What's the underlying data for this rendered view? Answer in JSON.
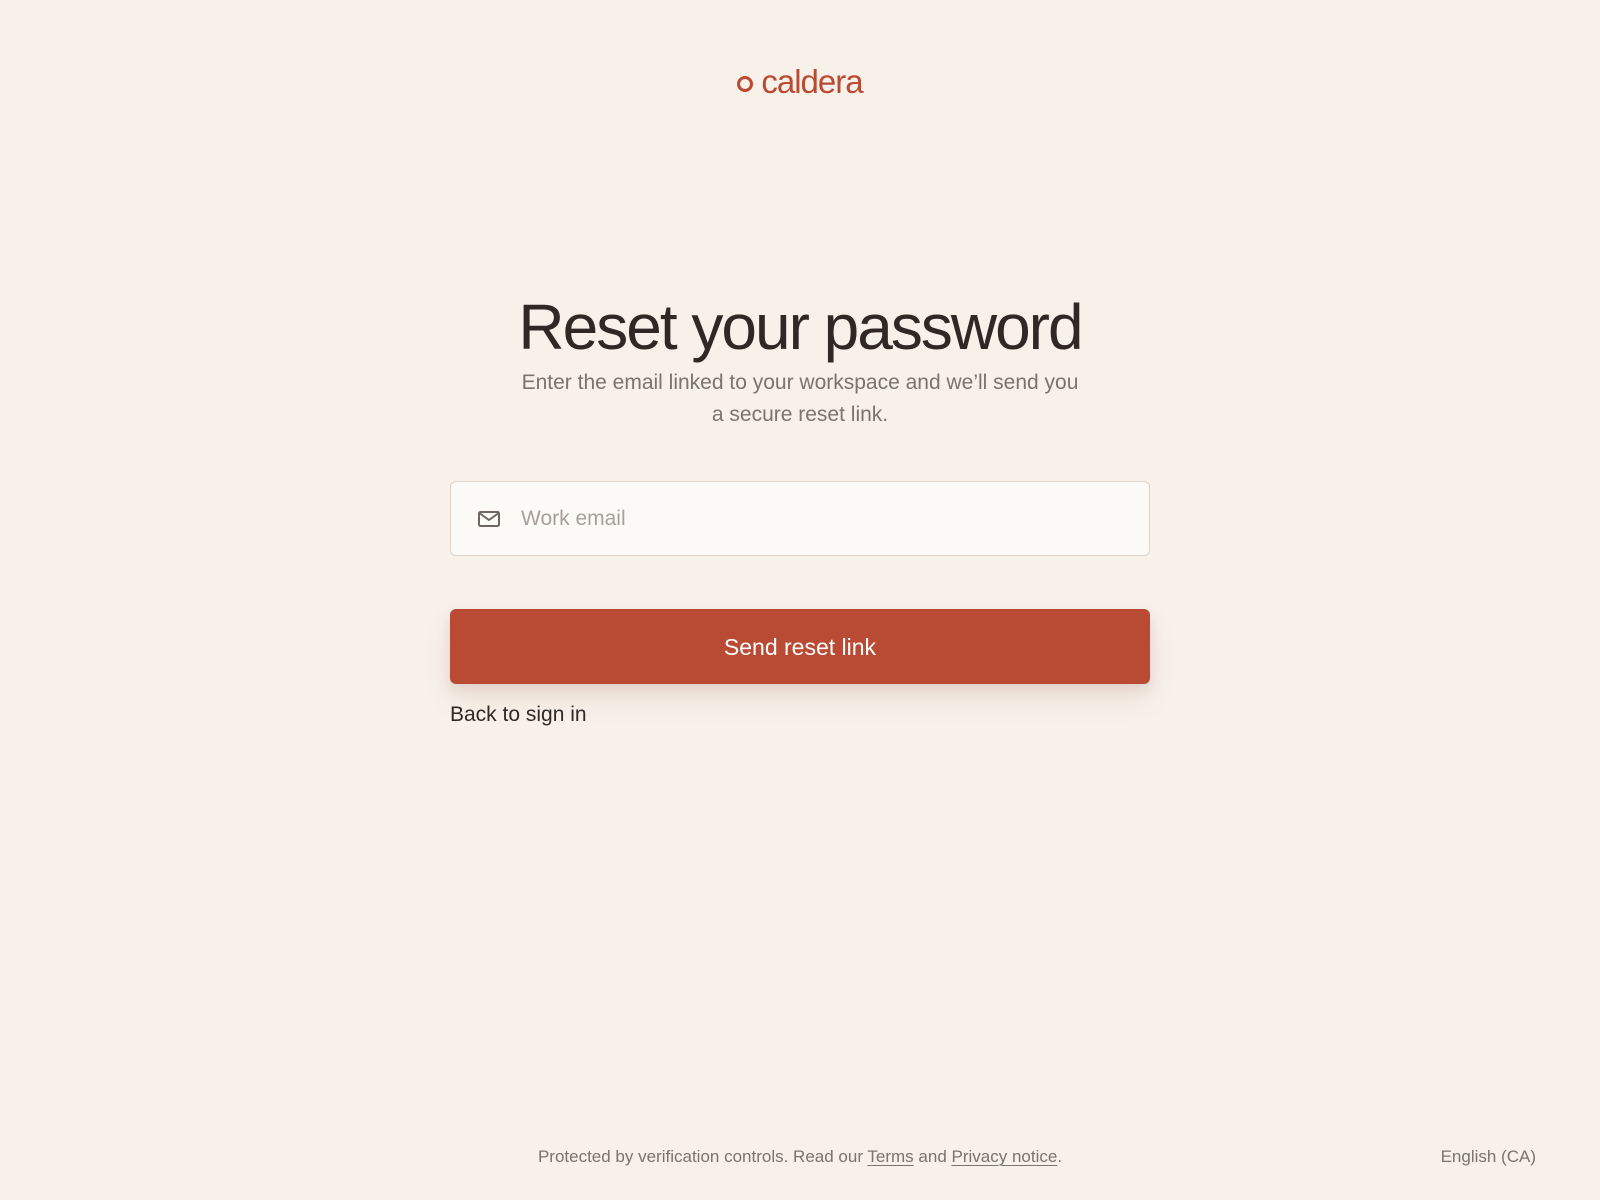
{
  "brand": {
    "name": "caldera",
    "color": "#bb4a33"
  },
  "main": {
    "title": "Reset your password",
    "subtitle": "Enter the email linked to your workspace and we’ll send you a secure reset link.",
    "email": {
      "placeholder": "Work email",
      "value": "",
      "icon": "mail-icon"
    },
    "send_button_label": "Send reset link",
    "back_link_label": "Back to sign in",
    "accent_color": "#b94b34"
  },
  "footer": {
    "text_before": "Protected by verification controls. Read our ",
    "terms_label": "Terms",
    "text_between": " and ",
    "privacy_label": "Privacy notice",
    "text_after": ".",
    "language_label": "English (CA)"
  }
}
